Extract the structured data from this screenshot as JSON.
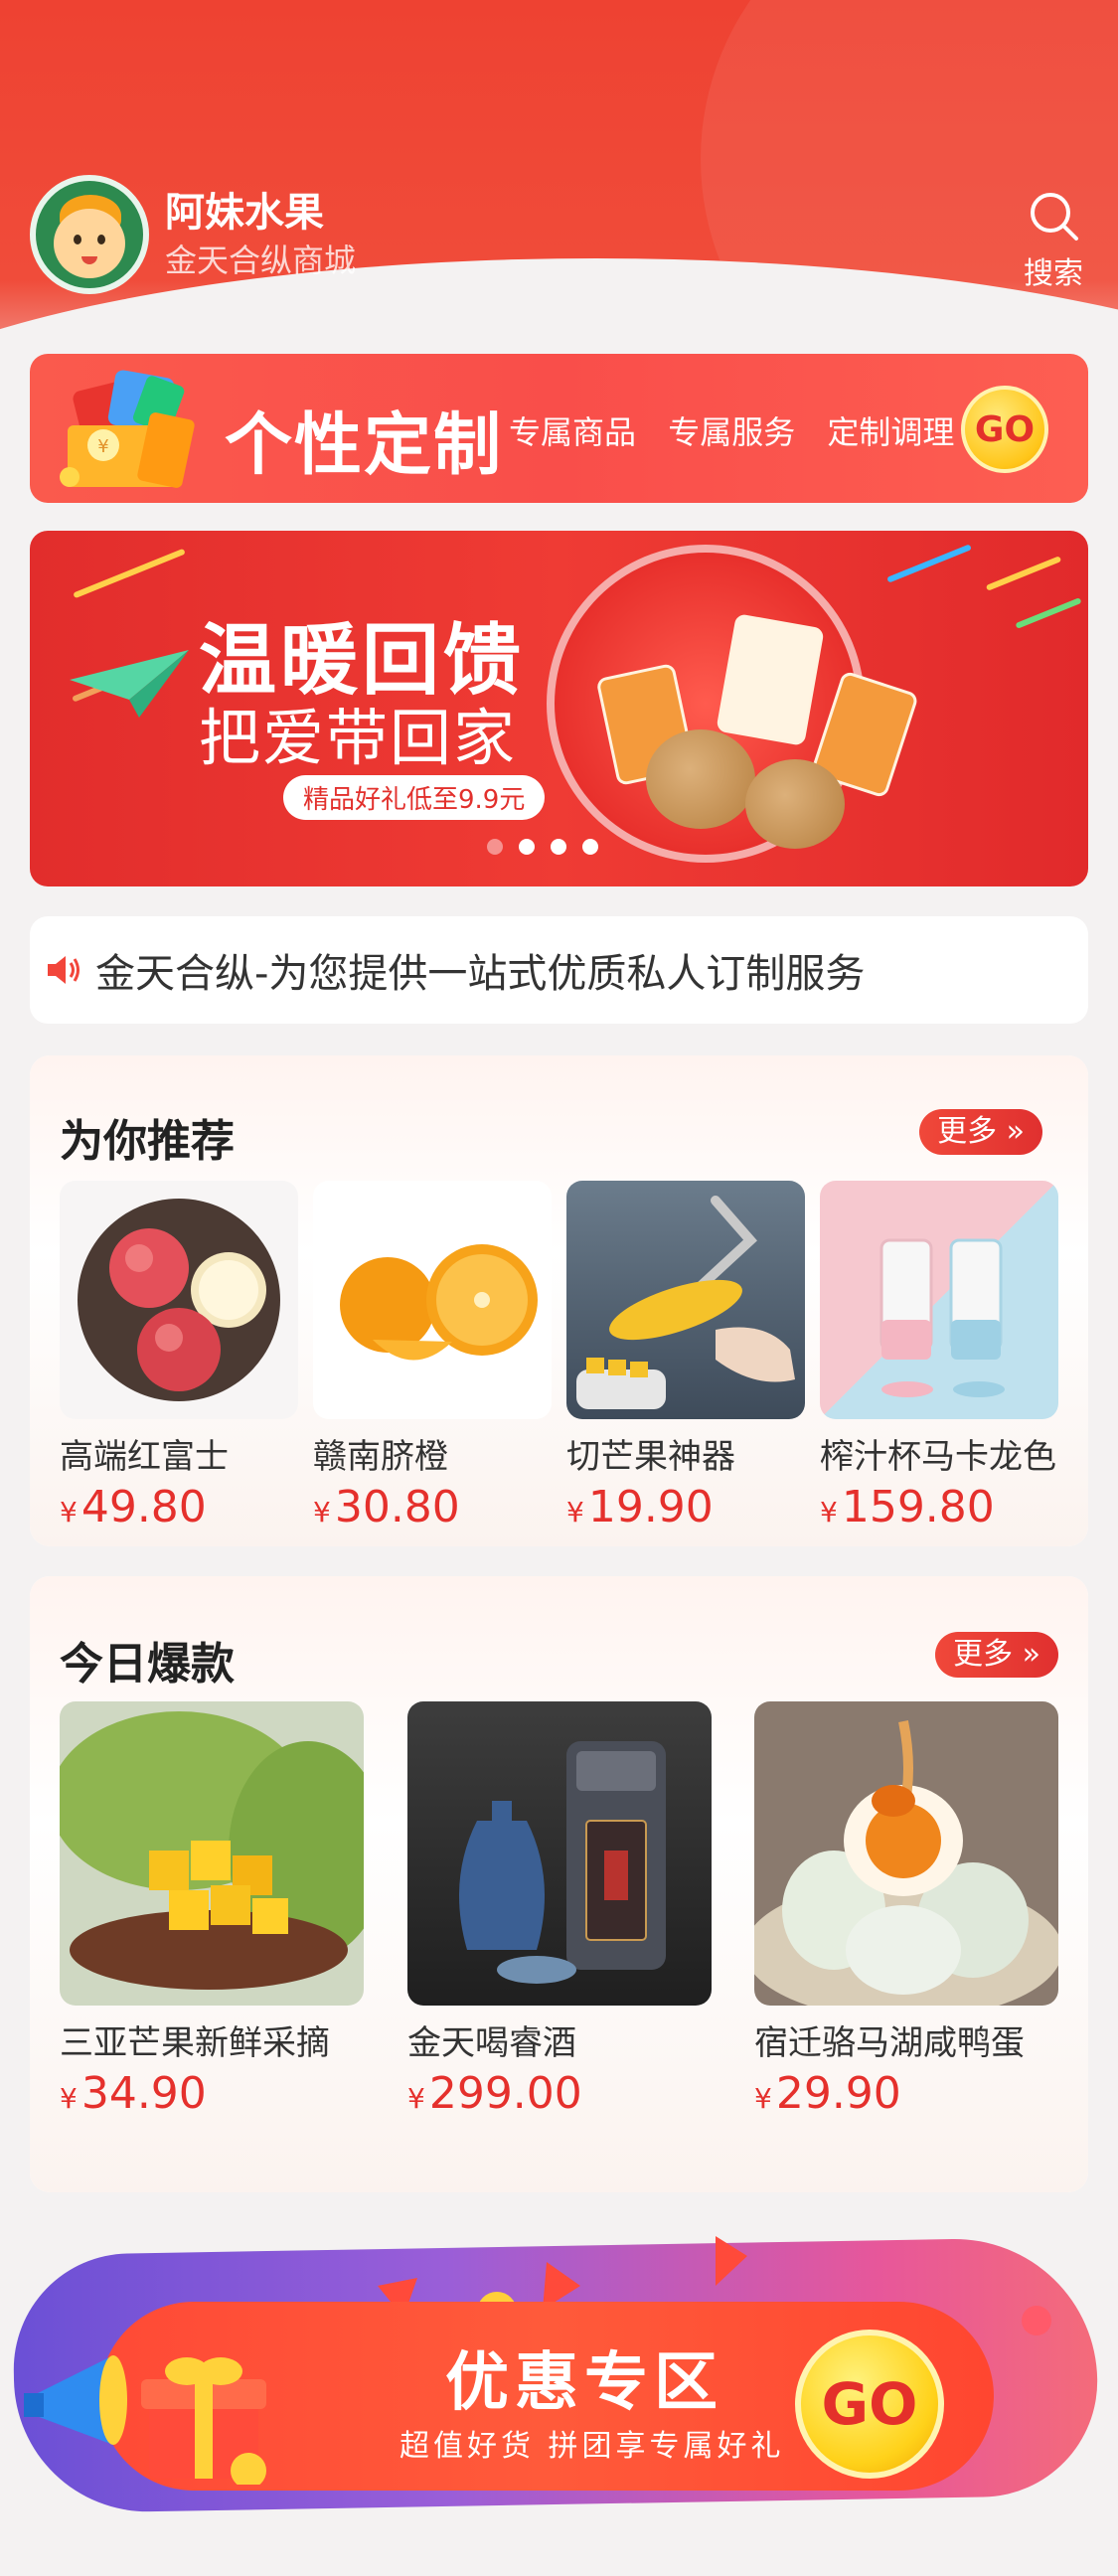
{
  "header": {
    "store_name": "阿妹水果",
    "store_subtitle": "金天合纵商城",
    "search_label": "搜索"
  },
  "custom_banner": {
    "title": "个性定制",
    "tags": [
      "专属商品",
      "专属服务",
      "定制调理"
    ],
    "go_label": "GO"
  },
  "carousel": {
    "headline": "温暖回馈",
    "subheadline": "把爱带回家",
    "pill": "精品好礼低至9.9元",
    "slide_count": 4,
    "active_index": 1
  },
  "notice": {
    "text": "金天合纵-为您提供一站式优质私人订制服务"
  },
  "recommend": {
    "title": "为你推荐",
    "more_label": "更多",
    "items": [
      {
        "name": "高端红富士",
        "currency": "¥",
        "price": "49.80"
      },
      {
        "name": "赣南脐橙",
        "currency": "¥",
        "price": "30.80"
      },
      {
        "name": "切芒果神器",
        "currency": "¥",
        "price": "19.90"
      },
      {
        "name": "榨汁杯马卡龙色",
        "currency": "¥",
        "price": "159.80"
      }
    ]
  },
  "hot_today": {
    "title": "今日爆款",
    "more_label": "更多",
    "items": [
      {
        "name": "三亚芒果新鲜采摘",
        "currency": "¥",
        "price": "34.90"
      },
      {
        "name": "金天喝睿酒",
        "currency": "¥",
        "price": "299.00"
      },
      {
        "name": "宿迁骆马湖咸鸭蛋",
        "currency": "¥",
        "price": "29.90"
      }
    ]
  },
  "promo": {
    "title": "优惠专区",
    "subtitle": "超值好货 拼团享专属好礼",
    "go_label": "GO"
  },
  "colors": {
    "brand_red": "#ee4232",
    "price_red": "#e5302c",
    "gold": "#ffc61a"
  }
}
